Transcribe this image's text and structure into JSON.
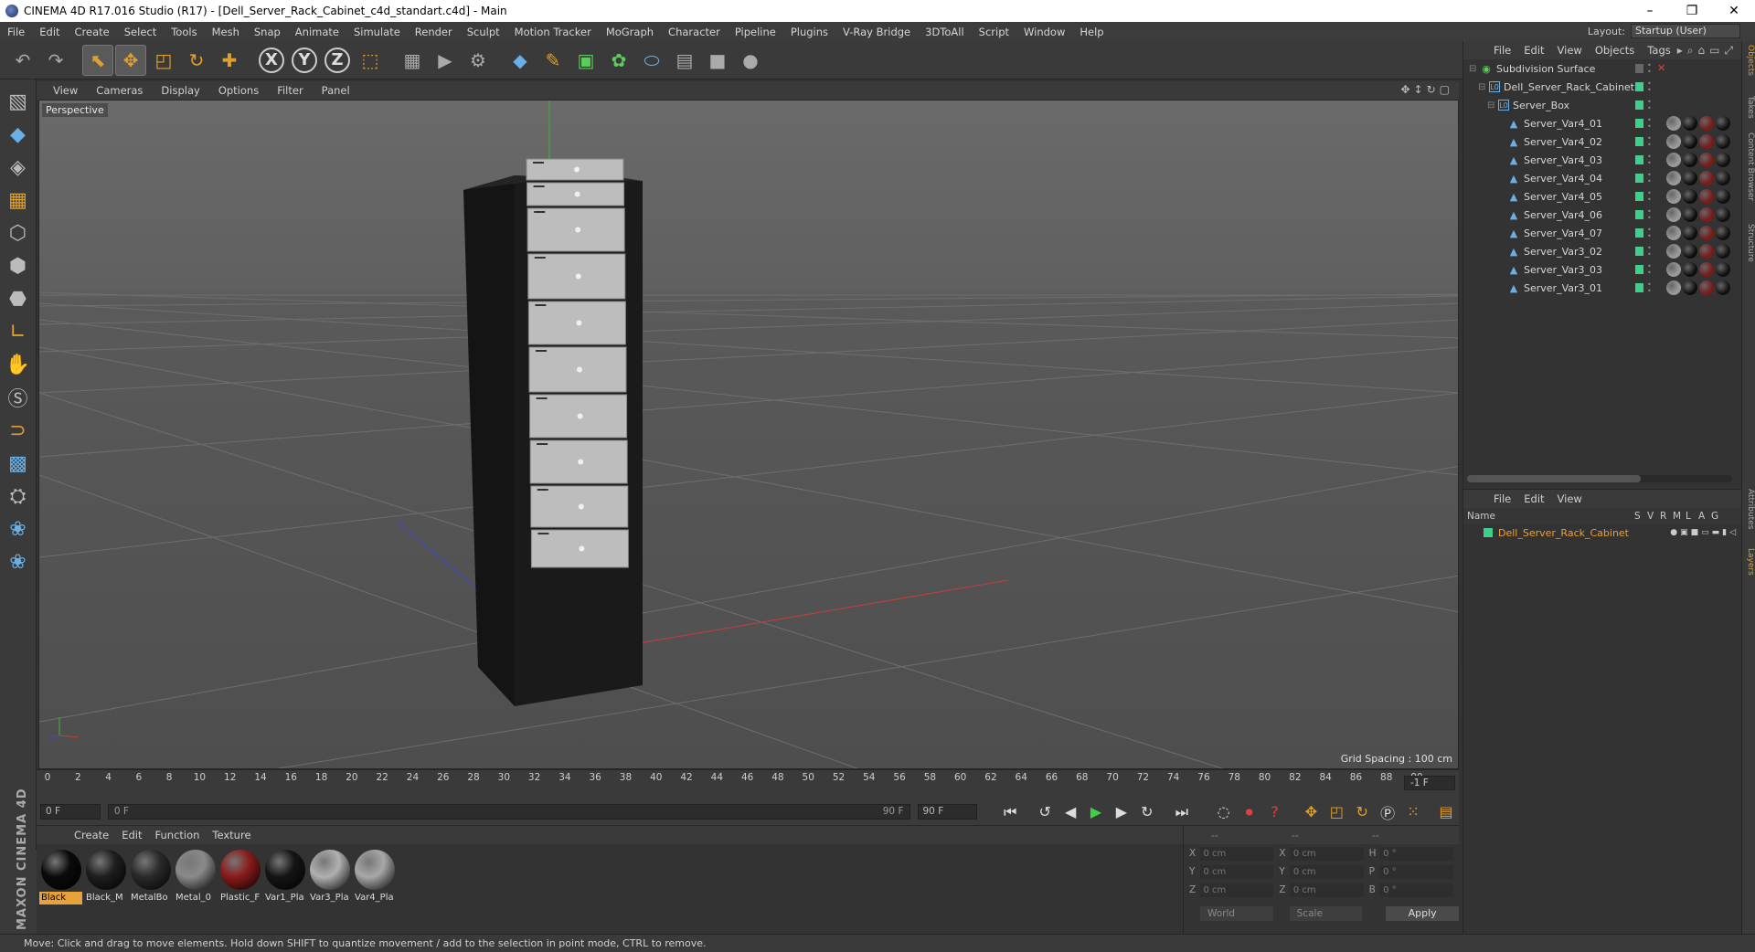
{
  "window": {
    "title": "CINEMA 4D R17.016 Studio (R17) - [Dell_Server_Rack_Cabinet_c4d_standart.c4d] - Main",
    "controls": [
      "–",
      "❐",
      "✕"
    ]
  },
  "menubar": {
    "items": [
      "File",
      "Edit",
      "Create",
      "Select",
      "Tools",
      "Mesh",
      "Snap",
      "Animate",
      "Simulate",
      "Render",
      "Sculpt",
      "Motion Tracker",
      "MoGraph",
      "Character",
      "Pipeline",
      "Plugins",
      "V-Ray Bridge",
      "3DToAll",
      "Script",
      "Window",
      "Help"
    ],
    "layout_label": "Layout:",
    "layout_value": "Startup (User)"
  },
  "viewport": {
    "menu": [
      "View",
      "Cameras",
      "Display",
      "Options",
      "Filter",
      "Panel"
    ],
    "camera_label": "Perspective",
    "grid_spacing": "Grid Spacing : 100 cm"
  },
  "timeline": {
    "ticks": [
      "0",
      "2",
      "4",
      "6",
      "8",
      "10",
      "12",
      "14",
      "16",
      "18",
      "20",
      "22",
      "24",
      "26",
      "28",
      "30",
      "32",
      "34",
      "36",
      "38",
      "40",
      "42",
      "44",
      "46",
      "48",
      "50",
      "52",
      "54",
      "56",
      "58",
      "60",
      "62",
      "64",
      "66",
      "68",
      "70",
      "72",
      "74",
      "76",
      "78",
      "80",
      "82",
      "84",
      "86",
      "88",
      "90"
    ],
    "current_frame_box": "-1 F"
  },
  "transport": {
    "start_frame": "0 F",
    "range_start": "0 F",
    "range_end": "90 F",
    "end_frame": "90 F"
  },
  "materials": {
    "menu": [
      "Create",
      "Edit",
      "Function",
      "Texture"
    ],
    "items": [
      {
        "label": "Black",
        "color": "#0a0a0a",
        "selected": true
      },
      {
        "label": "Black_M",
        "color": "#1e1e1e",
        "selected": false
      },
      {
        "label": "MetalBo",
        "color": "#2a2a2a",
        "selected": false
      },
      {
        "label": "Metal_0",
        "color": "#8a8a8a",
        "selected": false
      },
      {
        "label": "Plastic_F",
        "color": "#8b1a1a",
        "selected": false
      },
      {
        "label": "Var1_Pla",
        "color": "#151515",
        "selected": false
      },
      {
        "label": "Var3_Pla",
        "color": "#b0b0b0",
        "selected": false
      },
      {
        "label": "Var4_Pla",
        "color": "#a8a8a8",
        "selected": false
      }
    ],
    "brand": "MAXON CINEMA 4D"
  },
  "coordinates": {
    "header": [
      "--",
      "--",
      "--"
    ],
    "rows": [
      {
        "a1": "X",
        "v1": "0 cm",
        "a2": "X",
        "v2": "0 cm",
        "a3": "H",
        "v3": "0 °"
      },
      {
        "a1": "Y",
        "v1": "0 cm",
        "a2": "Y",
        "v2": "0 cm",
        "a3": "P",
        "v3": "0 °"
      },
      {
        "a1": "Z",
        "v1": "0 cm",
        "a2": "Z",
        "v2": "0 cm",
        "a3": "B",
        "v3": "0 °"
      }
    ],
    "space": "World",
    "mode": "Scale",
    "apply": "Apply"
  },
  "object_manager": {
    "menu": [
      "File",
      "Edit",
      "View",
      "Objects",
      "Tags"
    ],
    "objects": [
      {
        "name": "Subdivision Surface",
        "type": "sub",
        "tags": 0
      },
      {
        "name": "Dell_Server_Rack_Cabinet",
        "type": "null",
        "tags": 0
      },
      {
        "name": "Server_Box",
        "type": "null",
        "tags": 0
      },
      {
        "name": "Server_Var4_01",
        "type": "poly",
        "tags": 4
      },
      {
        "name": "Server_Var4_02",
        "type": "poly",
        "tags": 4
      },
      {
        "name": "Server_Var4_03",
        "type": "poly",
        "tags": 4
      },
      {
        "name": "Server_Var4_04",
        "type": "poly",
        "tags": 4
      },
      {
        "name": "Server_Var4_05",
        "type": "poly",
        "tags": 4
      },
      {
        "name": "Server_Var4_06",
        "type": "poly",
        "tags": 4
      },
      {
        "name": "Server_Var4_07",
        "type": "poly",
        "tags": 4
      },
      {
        "name": "Server_Var3_02",
        "type": "poly",
        "tags": 4
      },
      {
        "name": "Server_Var3_03",
        "type": "poly",
        "tags": 4
      },
      {
        "name": "Server_Var3_01",
        "type": "poly",
        "tags": 4
      }
    ]
  },
  "layer_manager": {
    "menu": [
      "File",
      "Edit",
      "View"
    ],
    "columns": [
      "Name",
      "S",
      "V",
      "R",
      "M",
      "L",
      "A",
      "G"
    ],
    "layers": [
      {
        "name": "Dell_Server_Rack_Cabinet"
      }
    ]
  },
  "right_tabs": [
    "Objects",
    "Takes",
    "Content Browser",
    "Structure"
  ],
  "right_tabs_lower": [
    "Attributes",
    "Layers"
  ],
  "status": "Move: Click and drag to move elements. Hold down SHIFT to quantize movement / add to the selection in point mode, CTRL to remove."
}
